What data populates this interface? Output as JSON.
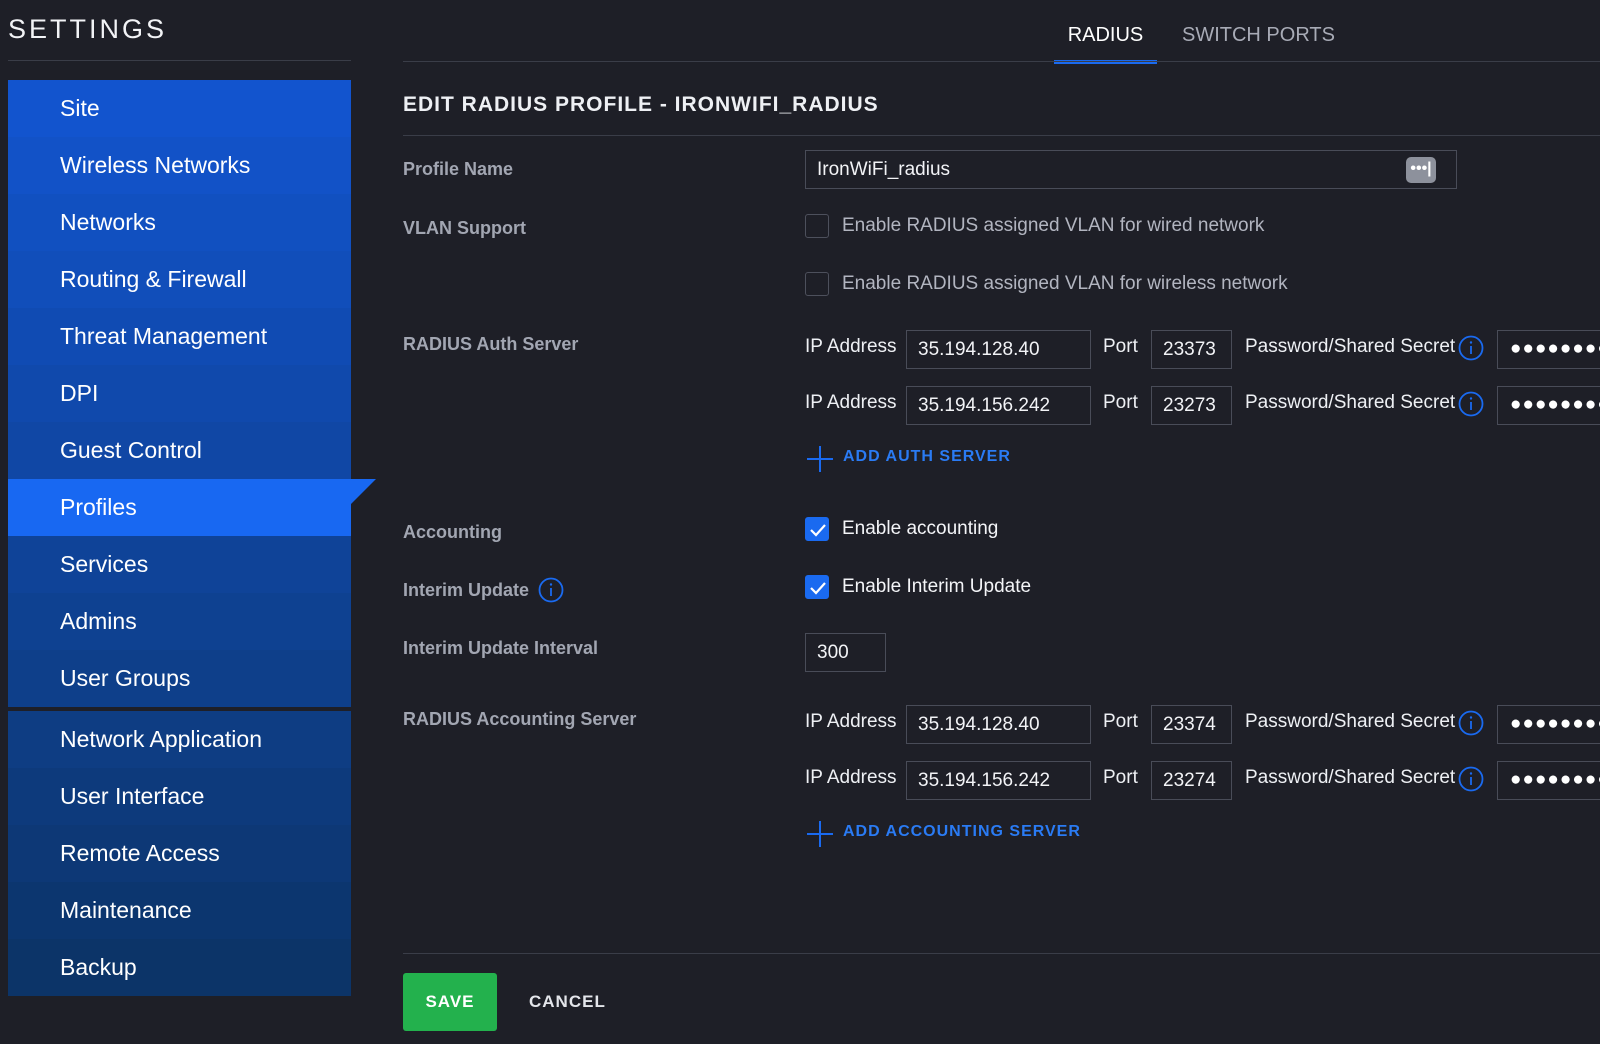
{
  "settings_title": "SETTINGS",
  "colors": {
    "accent": "#1a6af0",
    "active_nav": "#1868f2",
    "save_green": "#23b14d",
    "link_blue": "#2a7bf4",
    "background": "#1e1f27"
  },
  "sidebar": {
    "items": [
      {
        "label": "Site"
      },
      {
        "label": "Wireless Networks"
      },
      {
        "label": "Networks"
      },
      {
        "label": "Routing & Firewall"
      },
      {
        "label": "Threat Management"
      },
      {
        "label": "DPI"
      },
      {
        "label": "Guest Control"
      },
      {
        "label": "Profiles",
        "active": true
      },
      {
        "label": "Services"
      },
      {
        "label": "Admins"
      },
      {
        "label": "User Groups"
      }
    ],
    "items2": [
      {
        "label": "Network Application"
      },
      {
        "label": "User Interface"
      },
      {
        "label": "Remote Access"
      },
      {
        "label": "Maintenance"
      },
      {
        "label": "Backup"
      }
    ]
  },
  "tabs": [
    {
      "label": "RADIUS",
      "active": true
    },
    {
      "label": "SWITCH PORTS",
      "active": false
    }
  ],
  "form": {
    "heading": "EDIT RADIUS PROFILE - IRONWIFI_RADIUS",
    "profile_name": {
      "label": "Profile Name",
      "value": "IronWiFi_radius",
      "icon": "password-dots-icon",
      "icon_glyph": "•••|"
    },
    "vlan_support": {
      "label": "VLAN Support",
      "options": [
        {
          "label": "Enable RADIUS assigned VLAN for wired network",
          "checked": false
        },
        {
          "label": "Enable RADIUS assigned VLAN for wireless network",
          "checked": false
        }
      ]
    },
    "auth_server": {
      "label": "RADIUS Auth Server",
      "add_label": "ADD AUTH SERVER",
      "rows": [
        {
          "ip_label": "IP Address",
          "ip": "35.194.128.40",
          "port_label": "Port",
          "port": "23373",
          "secret_label": "Password/Shared Secret",
          "secret_mask": "●●●●●●●●●"
        },
        {
          "ip_label": "IP Address",
          "ip": "35.194.156.242",
          "port_label": "Port",
          "port": "23273",
          "secret_label": "Password/Shared Secret",
          "secret_mask": "●●●●●●●●●"
        }
      ]
    },
    "accounting": {
      "label": "Accounting",
      "option_label": "Enable accounting",
      "checked": true
    },
    "interim_update": {
      "label": "Interim Update",
      "option_label": "Enable Interim Update",
      "checked": true
    },
    "interim_interval": {
      "label": "Interim Update Interval",
      "value": "300"
    },
    "accounting_server": {
      "label": "RADIUS Accounting Server",
      "add_label": "ADD ACCOUNTING SERVER",
      "rows": [
        {
          "ip_label": "IP Address",
          "ip": "35.194.128.40",
          "port_label": "Port",
          "port": "23374",
          "secret_label": "Password/Shared Secret",
          "secret_mask": "●●●●●●●●●"
        },
        {
          "ip_label": "IP Address",
          "ip": "35.194.156.242",
          "port_label": "Port",
          "port": "23274",
          "secret_label": "Password/Shared Secret",
          "secret_mask": "●●●●●●●●●"
        }
      ]
    }
  },
  "actions": {
    "save_label": "SAVE",
    "cancel_label": "CANCEL"
  }
}
